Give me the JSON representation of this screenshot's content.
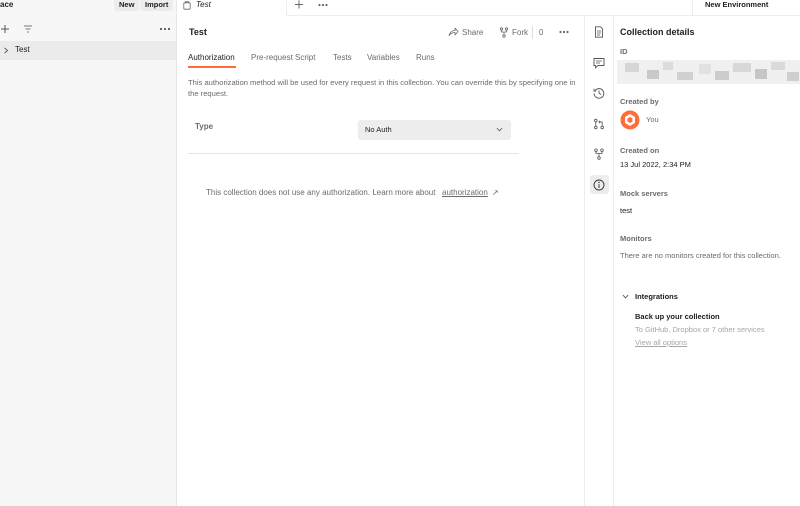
{
  "sidebar": {
    "workspace_title": "ace",
    "new_label": "New",
    "import_label": "Import",
    "collections": [
      {
        "label": "Test"
      }
    ]
  },
  "tabs": {
    "open_tab_label": "Test",
    "environment_label": "New Environment"
  },
  "main": {
    "title": "Test",
    "share_label": "Share",
    "fork_label": "Fork",
    "fork_count": "0",
    "tabs": [
      {
        "label": "Authorization"
      },
      {
        "label": "Pre-request Script"
      },
      {
        "label": "Tests"
      },
      {
        "label": "Variables"
      },
      {
        "label": "Runs"
      }
    ],
    "auth_description": "This authorization method will be used for every request in this collection. You can override this by specifying one in the request.",
    "type_label": "Type",
    "auth_type_value": "No Auth",
    "no_auth_text": "This collection does not use any authorization. Learn more about",
    "no_auth_link": "authorization",
    "no_auth_arrow": "↗"
  },
  "right_panel": {
    "title": "Collection details",
    "id_label": "ID",
    "created_by_label": "Created by",
    "created_by_value": "You",
    "created_on_label": "Created on",
    "created_on_value": "13 Jul 2022, 2:34 PM",
    "mock_servers_label": "Mock servers",
    "mock_servers_value": "test",
    "monitors_label": "Monitors",
    "monitors_value": "There are no monitors created for this collection.",
    "integrations_label": "Integrations",
    "backup_title": "Back up your collection",
    "backup_desc": "To GitHub, Dropbox or 7 other services",
    "view_all_label": "View all options"
  },
  "colors": {
    "accent": "#ff6c37",
    "sidebar_bg": "#f7f7f7",
    "selected_row_bg": "#ebebeb",
    "muted_text": "#6b6b6b"
  },
  "icons": [
    "plus-icon",
    "filter-icon",
    "more-icon",
    "chevron-right-icon",
    "collection-icon",
    "share-icon",
    "fork-icon",
    "chevron-down-icon",
    "document-icon",
    "comment-icon",
    "history-icon",
    "pull-request-icon",
    "info-icon",
    "avatar-icon"
  ]
}
